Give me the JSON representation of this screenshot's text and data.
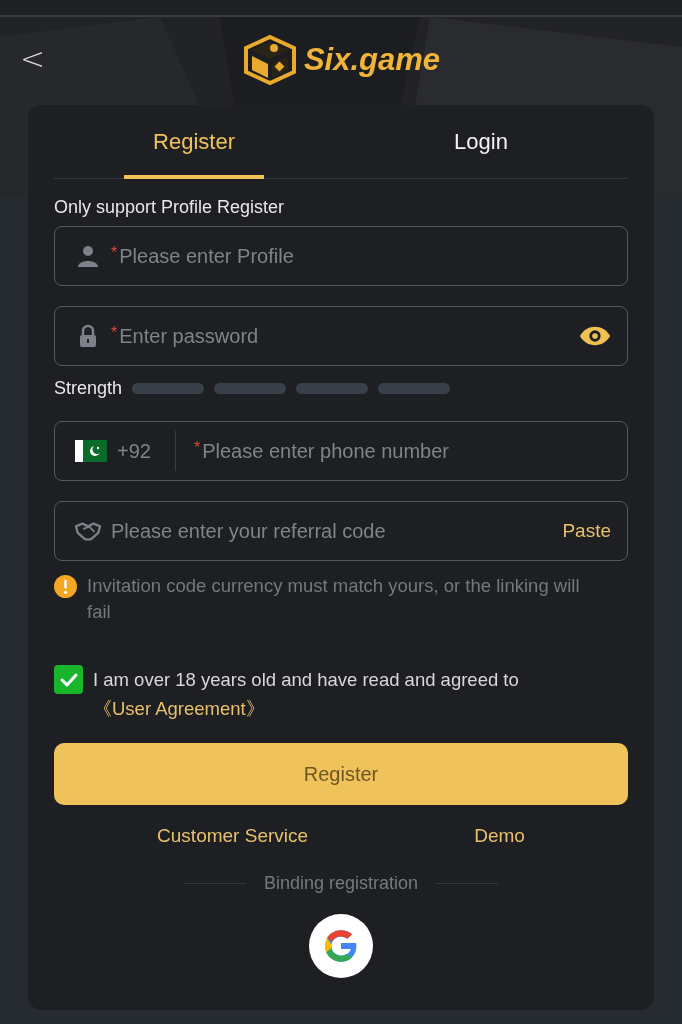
{
  "header": {
    "back": "<",
    "logo_text": "Six.game"
  },
  "tabs": [
    {
      "label": "Register",
      "selected": true
    },
    {
      "label": "Login",
      "selected": false
    }
  ],
  "notice_title": "Only support Profile Register",
  "fields": [
    {
      "kind": "profile",
      "marker": "*",
      "placeholder": "Please enter Profile"
    },
    {
      "kind": "password",
      "marker": "*",
      "placeholder": "Enter password"
    }
  ],
  "strength": {
    "label": "Strength"
  },
  "phone": {
    "code": "+92",
    "marker": "*",
    "placeholder": "Please enter phone number"
  },
  "referral": {
    "placeholder": "Please enter your referral code",
    "action": "Paste"
  },
  "warning": "Invitation code currency must match yours, or the linking will fail",
  "agreement": {
    "checked": true,
    "text": "I am over 18 years old and have read and agreed to",
    "link": "《User Agreement》"
  },
  "submit": "Register",
  "links": [
    "Customer Service",
    "Demo"
  ],
  "binding": {
    "label": "Binding registration"
  }
}
